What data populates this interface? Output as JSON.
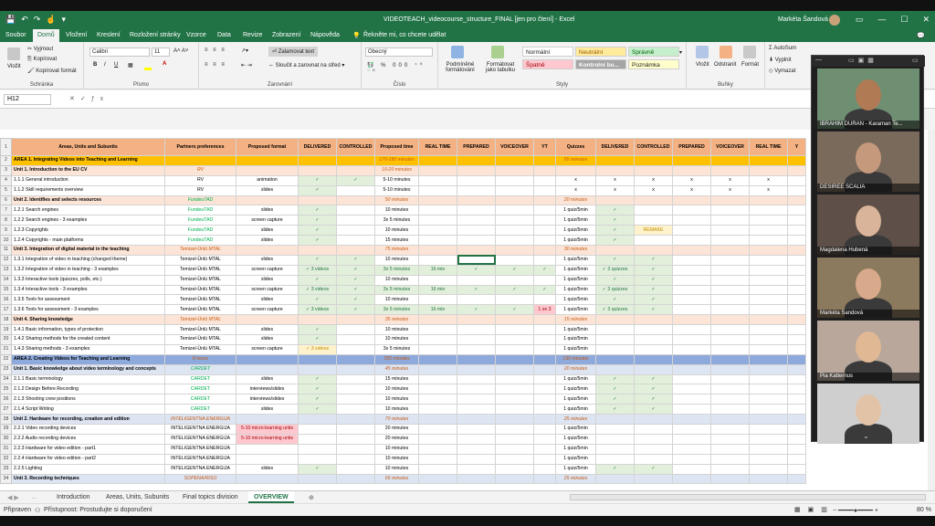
{
  "titlebar": {
    "doc_title": "VIDEOTEACH_videocourse_structure_FINAL  [jen pro čtení]  -  Excel",
    "user": "Markéta Šandová"
  },
  "tabs": [
    "Soubor",
    "Domů",
    "Vložení",
    "Kreslení",
    "Rozložení stránky",
    "Vzorce",
    "Data",
    "Revize",
    "Zobrazení",
    "Nápověda",
    "Řekněte mi, co chcete udělat"
  ],
  "ribbon": {
    "paste": "Vložit",
    "cut": "Vyjmout",
    "copy": "Kopírovat",
    "format_painter": "Kopírovat formát",
    "clipboard_label": "Schránka",
    "font_name": "Calibri",
    "font_size": "11",
    "font_label": "Písmo",
    "wrap": "Zalamovat text",
    "merge": "Sloučit a zarovnat na střed",
    "alignment_label": "Zarovnání",
    "number_format": "Obecný",
    "number_label": "Číslo",
    "cond_format": "Podmíněné formátování",
    "format_table": "Formátovat jako tabulku",
    "styles": [
      "Normální",
      "Neutrální",
      "Správně",
      "Špatně",
      "Kontrolní bu...",
      "Poznámka"
    ],
    "styles_label": "Styly",
    "insert": "Vložit",
    "delete": "Odstranit",
    "format": "Formát",
    "cells_label": "Buňky",
    "autosum": "AutoSum",
    "fill": "Vyplnit",
    "clear": "Vymazat"
  },
  "formula": {
    "namebox": "H12",
    "content": ""
  },
  "columns": [
    "A",
    "B",
    "C",
    "D",
    "E",
    "F",
    "G",
    "H",
    "I",
    "J",
    "K",
    "L",
    "M",
    "N",
    "O",
    "P",
    "Q"
  ],
  "header_row": [
    "Areas, Units and Subunits",
    "Partners preferences",
    "Proposed format",
    "DELIVERED",
    "CONTROLLED",
    "Proposed time",
    "REAL TIME",
    "PREPARED",
    "VOICEOVER",
    "YT",
    "Quizzes",
    "DELIVERED",
    "CONTROLLED",
    "PREPARED",
    "VOICEOVER",
    "REAL TIME",
    "Y"
  ],
  "rows": [
    {
      "n": "2",
      "t": "area",
      "c": [
        "AREA 1. Integrating Videos into Teaching and Learning",
        "",
        "",
        "",
        "",
        "170-180 minutes",
        "",
        "",
        "",
        "",
        "65 minutes",
        "",
        "",
        "",
        "",
        "",
        ""
      ]
    },
    {
      "n": "3",
      "t": "unit",
      "c": [
        "Unit 1. Introduction to the EU CV",
        "RV",
        "",
        "",
        "",
        "10-20 minutes",
        "",
        "",
        "",
        "",
        "",
        "",
        "",
        "",
        "",
        "",
        ""
      ]
    },
    {
      "n": "4",
      "t": "",
      "c": [
        "1.1.1 General introduction",
        "RV",
        "animation",
        "✓",
        "✓",
        "5-10 minutes",
        "",
        "",
        "",
        "",
        "x",
        "x",
        "x",
        "x",
        "x",
        "x",
        ""
      ]
    },
    {
      "n": "5",
      "t": "",
      "c": [
        "1.1.2 Skill requirements overview",
        "RV",
        "slides",
        "✓",
        "",
        "5-10 minutes",
        "",
        "",
        "",
        "",
        "x",
        "x",
        "x",
        "x",
        "x",
        "x",
        ""
      ]
    },
    {
      "n": "6",
      "t": "unit",
      "c": [
        "Unit 2. Identifies and selects resources",
        "FundeuTAD",
        "",
        "",
        "",
        "50 minutes",
        "",
        "",
        "",
        "",
        "20 minutes",
        "",
        "",
        "",
        "",
        "",
        ""
      ]
    },
    {
      "n": "7",
      "t": "",
      "c": [
        "1.2.1 Search engines",
        "FundeuTAD",
        "slides",
        "✓",
        "",
        "10 minutes",
        "",
        "",
        "",
        "",
        "1 quiz/5min",
        "✓",
        "",
        "",
        "",
        "",
        ""
      ]
    },
    {
      "n": "8",
      "t": "",
      "c": [
        "1.2.2 Search engines - 3 examples",
        "FundeuTAD",
        "screen capture",
        "✓",
        "",
        "3x 5 minutes",
        "",
        "",
        "",
        "",
        "1 quiz/5min",
        "✓",
        "",
        "",
        "",
        "",
        ""
      ]
    },
    {
      "n": "9",
      "t": "",
      "c": [
        "1.2.3 Copyrights",
        "FundeuTAD",
        "slides",
        "✓",
        "",
        "10 minutes",
        "",
        "",
        "",
        "",
        "1 quiz/5min",
        "✓",
        "REMAKE",
        "",
        "",
        "",
        ""
      ]
    },
    {
      "n": "10",
      "t": "",
      "c": [
        "1.2.4 Copyrights - main platforms",
        "FundeuTAD",
        "slides",
        "✓",
        "",
        "15 minutes",
        "",
        "",
        "",
        "",
        "1 quiz/5min",
        "✓",
        "",
        "",
        "",
        "",
        ""
      ]
    },
    {
      "n": "11",
      "t": "unit",
      "c": [
        "Unit 3. Integration of digital material in the teaching",
        "Temizel-Ünlü MTAL",
        "",
        "",
        "",
        "75 minutes",
        "",
        "",
        "",
        "",
        "30 minutes",
        "",
        "",
        "",
        "",
        "",
        ""
      ]
    },
    {
      "n": "12",
      "t": "",
      "c": [
        "1.3.1 Integration of video in teaching (changed theme)",
        "Temizel-Ünlü MTAL",
        "slides",
        "✓",
        "✓",
        "10 minutes",
        "",
        "",
        "",
        "",
        "1 quiz/5min",
        "✓",
        "✓",
        "",
        "",
        "",
        ""
      ]
    },
    {
      "n": "13",
      "t": "",
      "c": [
        "1.3.2 Integration of video in teaching - 3 examples",
        "Temizel-Ünlü MTAL",
        "screen capture",
        "✓ 3 videos",
        "✓",
        "3x 5 minutes",
        "16 min",
        "✓",
        "✓",
        "✓",
        "1 quiz/5min",
        "✓ 3 quizzes",
        "✓",
        "",
        "",
        "",
        ""
      ]
    },
    {
      "n": "14",
      "t": "",
      "c": [
        "1.3.3 Interactive tools (quizzes, polls, etc.)",
        "Temizel-Ünlü MTAL",
        "slides",
        "✓",
        "✓",
        "10 minutes",
        "",
        "",
        "",
        "",
        "1 quiz/5min",
        "✓",
        "✓",
        "",
        "",
        "",
        ""
      ]
    },
    {
      "n": "15",
      "t": "",
      "c": [
        "1.3.4 Interactive tools - 3 examples",
        "Temizel-Ünlü MTAL",
        "screen capture",
        "✓ 3 videos",
        "✓",
        "3x 5 minutes",
        "16 min",
        "✓",
        "✓",
        "✓",
        "1 quiz/5min",
        "✓ 3 quizzes",
        "✓",
        "",
        "",
        "",
        ""
      ]
    },
    {
      "n": "16",
      "t": "",
      "c": [
        "1.3.5 Tools for assessment",
        "Temizel-Ünlü MTAL",
        "slides",
        "✓",
        "✓",
        "10 minutes",
        "",
        "",
        "",
        "",
        "1 quiz/5min",
        "✓",
        "✓",
        "",
        "",
        "",
        ""
      ]
    },
    {
      "n": "17",
      "t": "",
      "c": [
        "1.3.6 Tools for assessment - 3 examples",
        "Temizel-Ünlü MTAL",
        "screen capture",
        "✓ 3 videos",
        "✓",
        "3x 5 minutes",
        "16 min",
        "✓",
        "✓",
        "1 ze 3",
        "1 quiz/5min",
        "✓ 3 quizzes",
        "✓",
        "",
        "",
        "",
        ""
      ]
    },
    {
      "n": "18",
      "t": "unit",
      "c": [
        "Unit 4. Sharing knowledge",
        "Temizel-Ünlü MTAL",
        "",
        "",
        "",
        "35 minutes",
        "",
        "",
        "",
        "",
        "15 minutes",
        "",
        "",
        "",
        "",
        "",
        ""
      ]
    },
    {
      "n": "19",
      "t": "",
      "c": [
        "1.4.1 Basic information, types of protection",
        "Temizel-Ünlü MTAL",
        "slides",
        "✓",
        "",
        "10 minutes",
        "",
        "",
        "",
        "",
        "1 quiz/5min",
        "",
        "",
        "",
        "",
        "",
        ""
      ]
    },
    {
      "n": "20",
      "t": "",
      "c": [
        "1.4.2 Sharing methods for the created content",
        "Temizel-Ünlü MTAL",
        "slides",
        "✓",
        "",
        "10 minutes",
        "",
        "",
        "",
        "",
        "1 quiz/5min",
        "",
        "",
        "",
        "",
        "",
        ""
      ]
    },
    {
      "n": "21",
      "t": "",
      "c": [
        "1.4.3 Sharing methods - 3 examples",
        "Temizel-Ünlü MTAL",
        "screen capture",
        "✓ 3 videos",
        "",
        "3x 5 minutes",
        "",
        "",
        "",
        "",
        "1 quiz/5min",
        "",
        "",
        "",
        "",
        "",
        ""
      ]
    },
    {
      "n": "22",
      "t": "area2",
      "c": [
        "AREA 2. Creating Videos for Teaching and Learning",
        "8 hours",
        "",
        "",
        "",
        "355 minutes",
        "",
        "",
        "",
        "",
        "130 minutes",
        "",
        "",
        "",
        "",
        "",
        ""
      ]
    },
    {
      "n": "23",
      "t": "unit2",
      "c": [
        "Unit 1. Basic knowledge about video terminology and concepts",
        "CARDET",
        "",
        "",
        "",
        "45 minutes",
        "",
        "",
        "",
        "",
        "20 minutes",
        "",
        "",
        "",
        "",
        "",
        ""
      ]
    },
    {
      "n": "24",
      "t": "",
      "c": [
        "2.1.1 Basic terminology",
        "CARDET",
        "slides",
        "✓",
        "",
        "15 minutes",
        "",
        "",
        "",
        "",
        "1 quiz/5min",
        "✓",
        "✓",
        "",
        "",
        "",
        ""
      ]
    },
    {
      "n": "25",
      "t": "",
      "c": [
        "2.1.2 Design Before Recording",
        "CARDET",
        "interviews/slides",
        "✓",
        "",
        "10 minutes",
        "",
        "",
        "",
        "",
        "1 quiz/5min",
        "✓",
        "✓",
        "",
        "",
        "",
        ""
      ]
    },
    {
      "n": "26",
      "t": "",
      "c": [
        "2.1.3 Shooting crew positions",
        "CARDET",
        "interviews/slides",
        "✓",
        "",
        "10 minutes",
        "",
        "",
        "",
        "",
        "1 quiz/5min",
        "✓",
        "✓",
        "",
        "",
        "",
        ""
      ]
    },
    {
      "n": "27",
      "t": "",
      "c": [
        "2.1.4 Script Writing",
        "CARDET",
        "slides",
        "✓",
        "",
        "10 minutes",
        "",
        "",
        "",
        "",
        "1 quiz/5min",
        "✓",
        "✓",
        "",
        "",
        "",
        ""
      ]
    },
    {
      "n": "28",
      "t": "unit2",
      "c": [
        "Unit 2. Hardware for recording, creation and edition",
        "INTELIGENTNA ENERGIJA",
        "",
        "",
        "",
        "70 minutes",
        "",
        "",
        "",
        "",
        "25 minutes",
        "",
        "",
        "",
        "",
        "",
        ""
      ]
    },
    {
      "n": "29",
      "t": "",
      "c": [
        "2.2.1 Video recording devices",
        "INTELIGENTNA ENERGIJA",
        "5-10 micro-learning units",
        "",
        "",
        "20 minutes",
        "",
        "",
        "",
        "",
        "1 quiz/5min",
        "",
        "",
        "",
        "",
        "",
        ""
      ]
    },
    {
      "n": "30",
      "t": "",
      "c": [
        "2.2.2 Audio recording devices",
        "INTELIGENTNA ENERGIJA",
        "5-10 micro-learning units",
        "",
        "",
        "20 minutes",
        "",
        "",
        "",
        "",
        "1 quiz/5min",
        "",
        "",
        "",
        "",
        "",
        ""
      ]
    },
    {
      "n": "31",
      "t": "",
      "c": [
        "2.2.3 Hardware for video edition - part1",
        "INTELIGENTNA ENERGIJA",
        "",
        "",
        "",
        "10 minutes",
        "",
        "",
        "",
        "",
        "1 quiz/5min",
        "",
        "",
        "",
        "",
        "",
        ""
      ]
    },
    {
      "n": "32",
      "t": "",
      "c": [
        "2.2.4 Hardware for video edition - part2",
        "INTELIGENTNA ENERGIJA",
        "",
        "",
        "",
        "10 minutes",
        "",
        "",
        "",
        "",
        "1 quiz/5min",
        "",
        "",
        "",
        "",
        "",
        ""
      ]
    },
    {
      "n": "33",
      "t": "",
      "c": [
        "2.2.5 Lighting",
        "INTELIGENTNA ENERGIJA",
        "slides",
        "✓",
        "",
        "10 minutes",
        "",
        "",
        "",
        "",
        "1 quiz/5min",
        "✓",
        "✓",
        "",
        "",
        "",
        ""
      ]
    },
    {
      "n": "34",
      "t": "unit2",
      "c": [
        "Unit 3. Recording techniques",
        "SOPENA/RISO",
        "",
        "",
        "",
        "65 minutes",
        "",
        "",
        "",
        "",
        "25 minutes",
        "",
        "",
        "",
        "",
        "",
        ""
      ]
    }
  ],
  "sheet_tabs": [
    "Introduction",
    "Areas, Units, Subunits",
    "Final topics division",
    "OVERVIEW"
  ],
  "active_sheet": "OVERVIEW",
  "status": {
    "ready": "Připraven",
    "accessibility": "Přístupnost: Prostudujte si doporučení",
    "zoom": "80 %"
  },
  "participants": [
    {
      "name": "IBRAHIM DURAN - Karaman Te...",
      "skin": "#b07a55",
      "bg": "#6f8f72"
    },
    {
      "name": "DESIREE SCALIA",
      "skin": "#c59a7c",
      "bg": "#7a6a5c"
    },
    {
      "name": "Magdalena Hubená",
      "skin": "#d9b49a",
      "bg": "#5e5048"
    },
    {
      "name": "Markéta Šandová",
      "skin": "#d8a98a",
      "bg": "#8c7a5e"
    },
    {
      "name": "Pia Katternus",
      "skin": "#e0b894",
      "bg": "#b8a79a"
    },
    {
      "name": "",
      "skin": "#e2c3a8",
      "bg": "#cfcfcf"
    }
  ]
}
